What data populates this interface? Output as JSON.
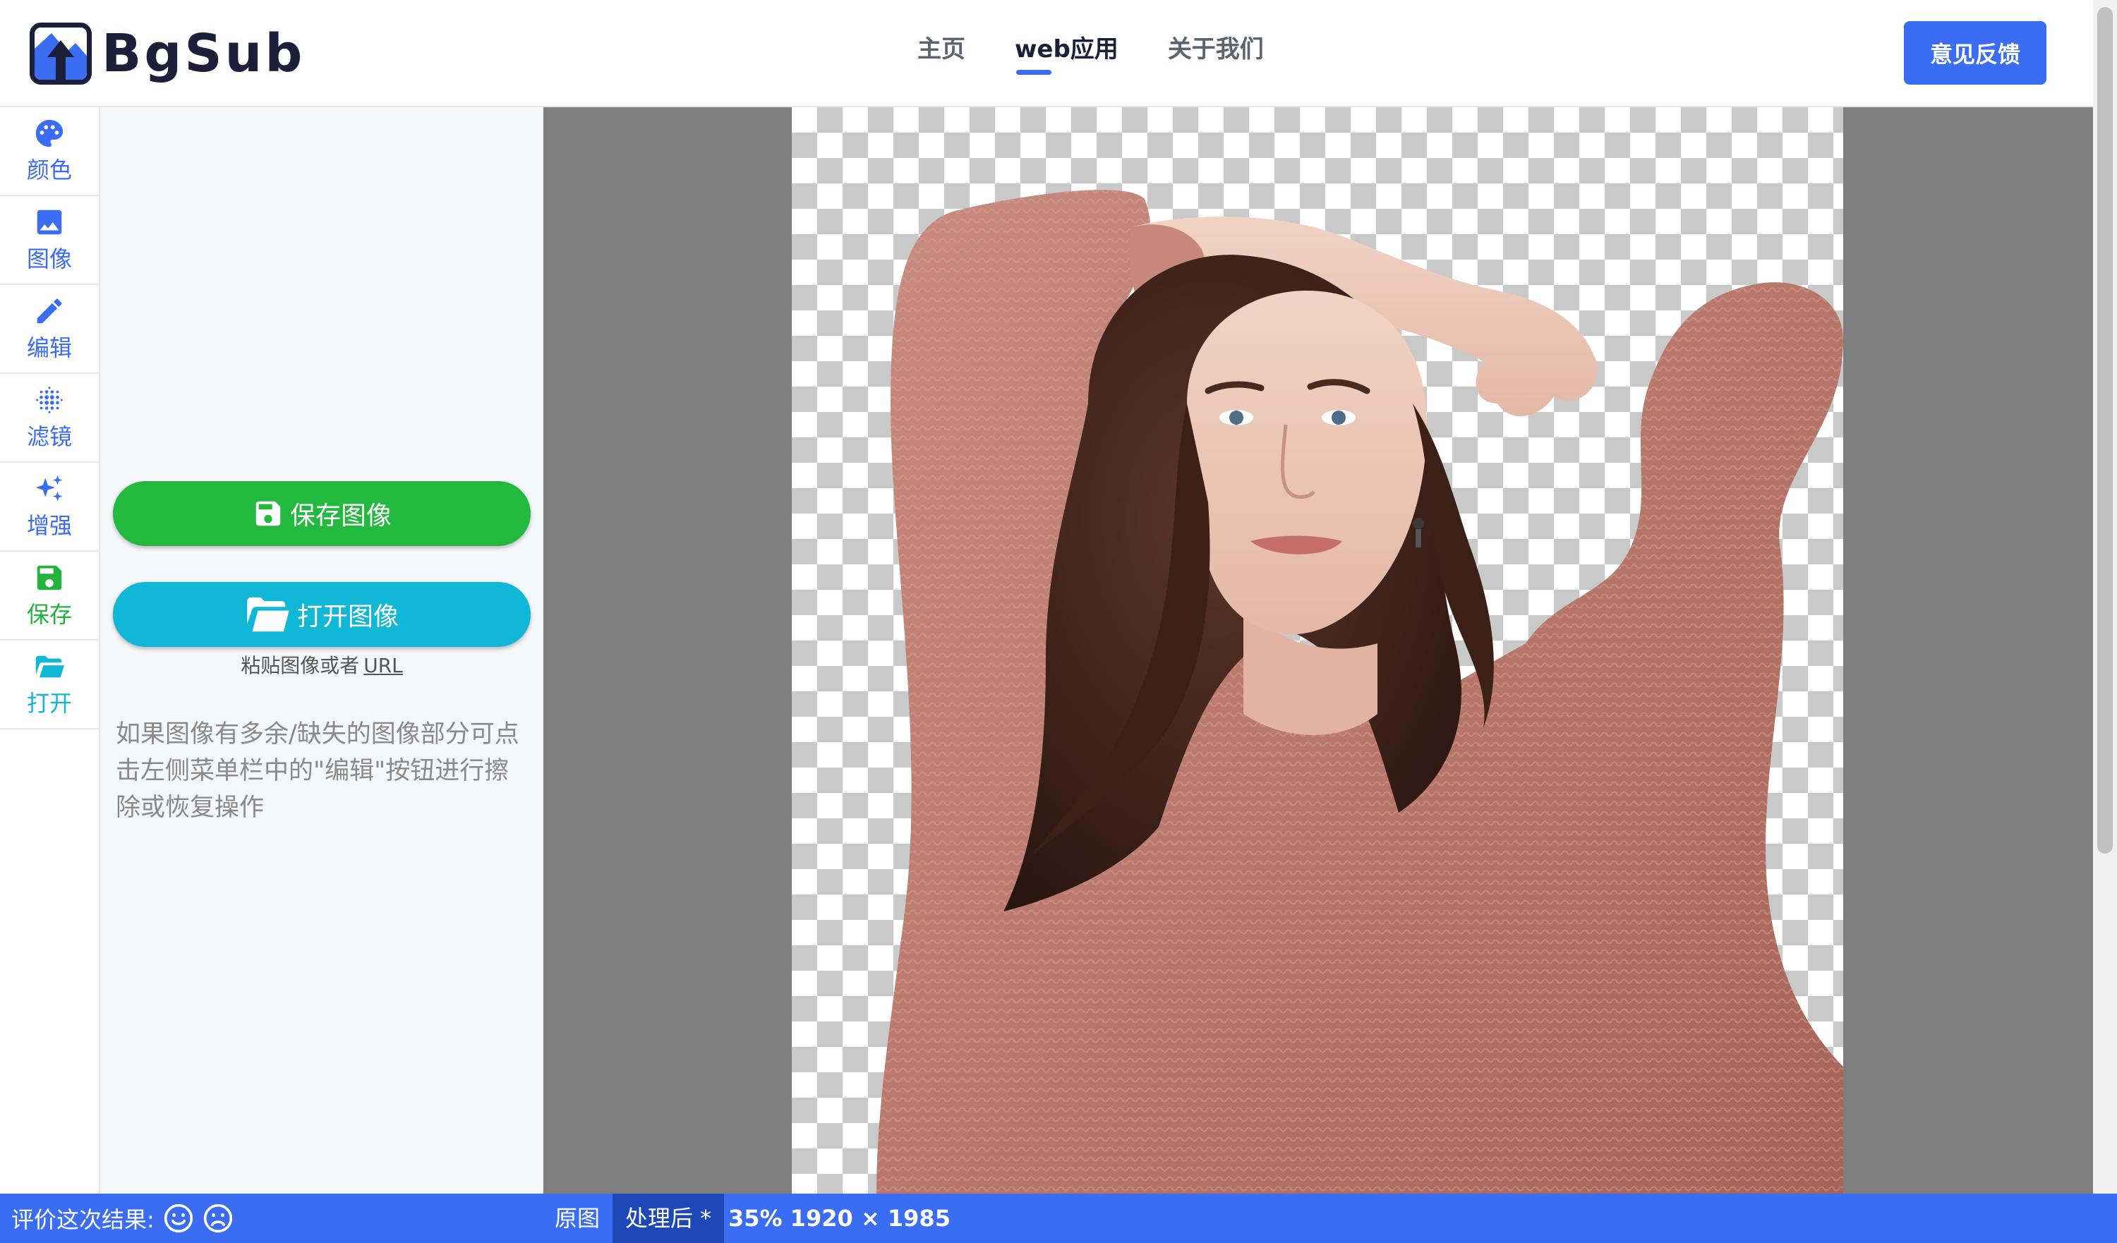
{
  "header": {
    "logo_text": "BgSub",
    "nav": [
      {
        "label": "主页",
        "active": false
      },
      {
        "label": "web应用",
        "active": true
      },
      {
        "label": "关于我们",
        "active": false
      }
    ],
    "feedback_label": "意见反馈"
  },
  "toolbar": {
    "items": [
      {
        "label": "颜色",
        "icon": "palette-icon"
      },
      {
        "label": "图像",
        "icon": "image-icon"
      },
      {
        "label": "编辑",
        "icon": "pencil-icon"
      },
      {
        "label": "滤镜",
        "icon": "dots-filter-icon"
      },
      {
        "label": "增强",
        "icon": "sparkle-icon"
      },
      {
        "label": "保存",
        "icon": "floppy-icon"
      },
      {
        "label": "打开",
        "icon": "folder-open-icon"
      }
    ]
  },
  "panel": {
    "save_label": "保存图像",
    "open_label": "打开图像",
    "paste_prefix": "粘贴图像或者",
    "paste_url": "URL",
    "hint": "如果图像有多余/缺失的图像部分可点击左侧菜单栏中的\"编辑\"按钮进行擦除或恢复操作"
  },
  "statusbar": {
    "rate_label": "评价这次结果:",
    "view_original": "原图",
    "view_processed": "处理后 *",
    "info": "35% 1920 × 1985"
  },
  "colors": {
    "accent": "#3b6cf4",
    "save_green": "#23b83e",
    "open_cyan": "#10b7d6"
  }
}
